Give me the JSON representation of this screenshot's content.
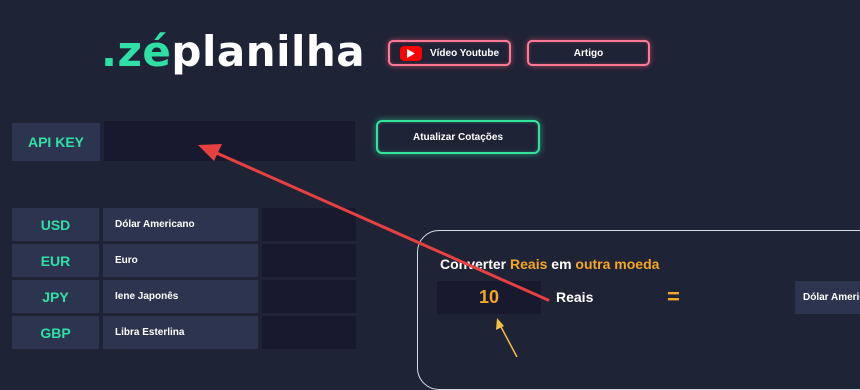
{
  "brand": {
    "dot": ".",
    "ze": "zé",
    "rest": "planilha"
  },
  "header_buttons": {
    "youtube_label": "Vídeo Youtube",
    "artigo_label": "Artigo"
  },
  "api_key": {
    "label": "API KEY",
    "value": ""
  },
  "update_button_label": "Atualizar Cotações",
  "currencies": [
    {
      "code": "USD",
      "name": "Dólar Americano"
    },
    {
      "code": "EUR",
      "name": "Euro"
    },
    {
      "code": "JPY",
      "name": "Iene Japonês"
    },
    {
      "code": "GBP",
      "name": "Libra Esterlina"
    }
  ],
  "converter": {
    "title_prefix": "Converter",
    "title_reais": "Reais",
    "title_mid": "em",
    "title_outra": "outra moeda",
    "amount": "10",
    "amount_unit": "Reais",
    "equals": "=",
    "target_currency": "Dólar Americano"
  },
  "colors": {
    "background": "#1f2336",
    "accent_green": "#2fe0a6",
    "accent_orange": "#f5a623",
    "annotation_arrow": "#e8403f"
  }
}
